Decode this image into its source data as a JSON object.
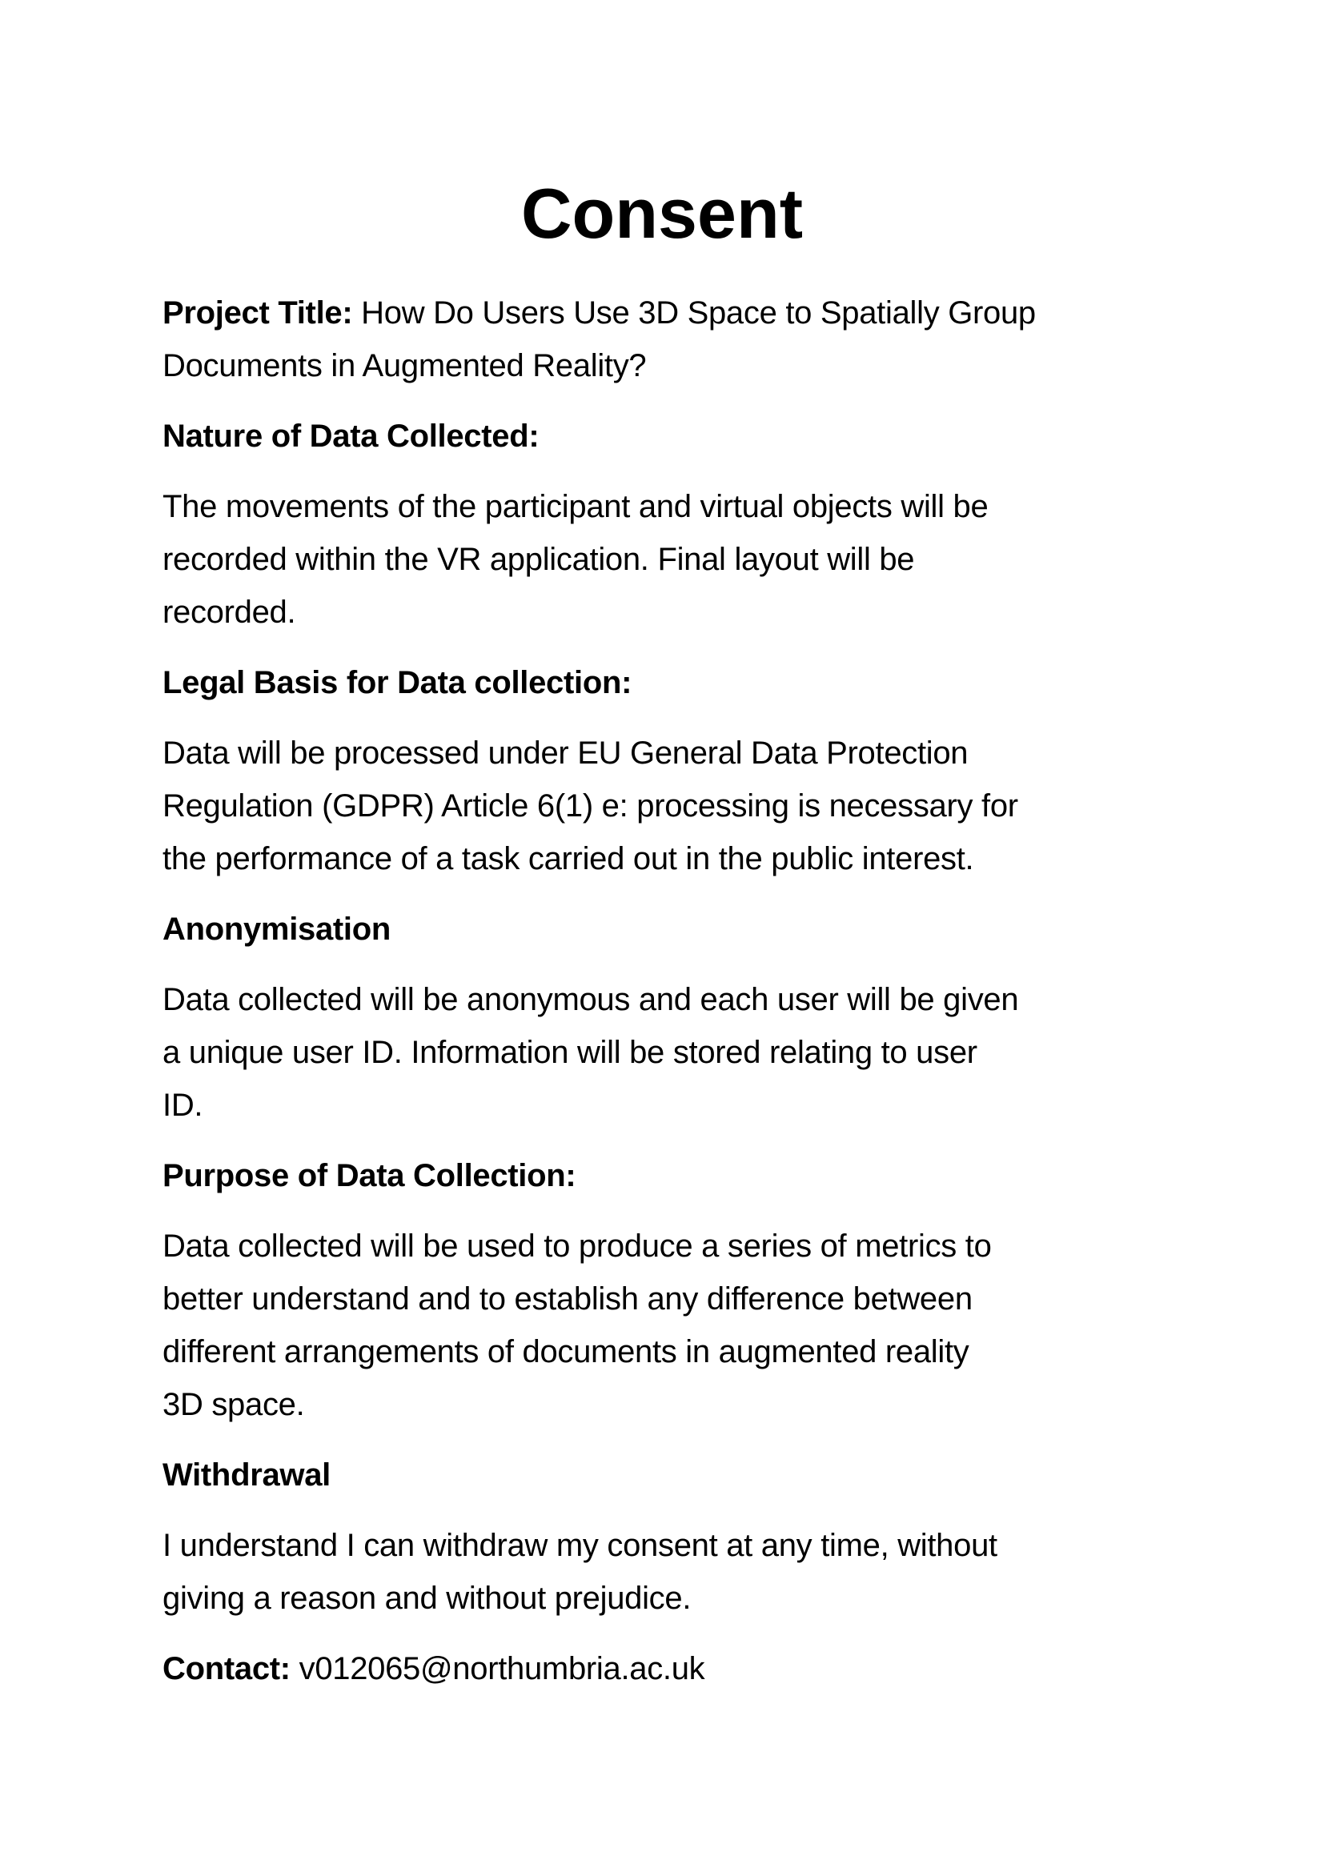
{
  "title": "Consent",
  "project": {
    "label": "Project Title:",
    "lines": [
      " How Do Users Use 3D Space to Spatially Group",
      "Documents in Augmented Reality?"
    ]
  },
  "sections": [
    {
      "heading": "Nature of Data Collected:",
      "lines": [
        "The movements of the participant and virtual objects will be",
        "recorded within the VR application. Final layout will be",
        "recorded."
      ]
    },
    {
      "heading": "Legal Basis for Data collection:",
      "lines": [
        "Data will be processed under EU General Data Protection",
        "Regulation (GDPR) Article 6(1) e: processing is necessary for",
        "the performance of a task carried out in the public interest."
      ]
    },
    {
      "heading": "Anonymisation",
      "lines": [
        "Data collected will be anonymous and each user will be given",
        "a unique user ID. Information will be stored relating to user",
        "ID."
      ]
    },
    {
      "heading": "Purpose of Data Collection:",
      "lines": [
        "Data collected will be used to produce a series of metrics to",
        "better understand and to establish any difference between",
        "different arrangements of documents in augmented reality",
        "3D space."
      ]
    },
    {
      "heading": "Withdrawal",
      "lines": [
        "I understand I can withdraw my consent at any time, without",
        "giving a reason and without prejudice."
      ]
    }
  ],
  "contact": {
    "label": "Contact:",
    "value": " v012065@northumbria.ac.uk"
  }
}
